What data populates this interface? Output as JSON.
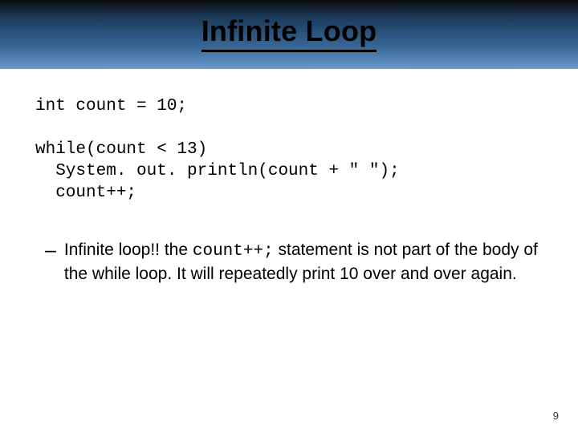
{
  "title": "Infinite Loop",
  "code": {
    "line1": "int count = 10;",
    "blank1": "",
    "line2": "while(count < 13)",
    "line3": "  System. out. println(count + \" \");",
    "line4": "  count++;"
  },
  "bullet": {
    "dash": "–",
    "seg1": "Infinite loop!! the ",
    "code_inline": "count++;",
    "seg2": " statement is not part of the body of the while loop. It will repeatedly print 10 over and over again."
  },
  "page_number": "9"
}
